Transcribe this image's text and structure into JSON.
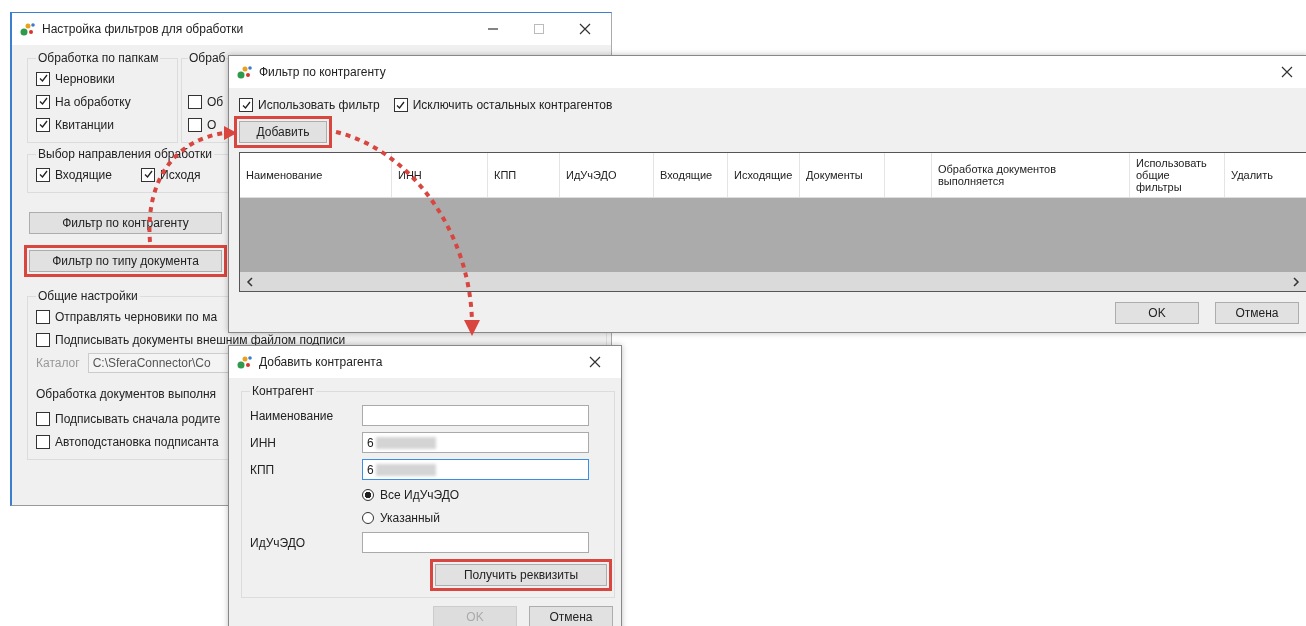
{
  "main_window": {
    "title": "Настройка фильтров для обработки",
    "folder_group": {
      "title": "Обработка по папкам",
      "items": [
        {
          "label": "Черновики",
          "checked": true
        },
        {
          "label": "На обработку",
          "checked": true
        },
        {
          "label": "Квитанции",
          "checked": true
        }
      ]
    },
    "second_group": {
      "title": "Обраб",
      "items": [
        {
          "label": "Об",
          "checked": false
        },
        {
          "label": "О",
          "checked": false
        }
      ]
    },
    "direction_group": {
      "title": "Выбор направления обработки",
      "items": [
        {
          "label": "Входящие",
          "checked": true
        },
        {
          "label": "Исходя",
          "checked": true
        }
      ]
    },
    "buttons": [
      {
        "label": "Фильтр по контрагенту",
        "highlighted": false
      },
      {
        "label": "Фильтр по типу документа",
        "highlighted": true
      }
    ],
    "general_group": {
      "title": "Общие настройки",
      "items": [
        {
          "label": "Отправлять черновики по ма",
          "checked": false
        },
        {
          "label": "Подписывать документы внешним файлом подписи",
          "checked": false
        }
      ],
      "catalog": {
        "label": "Каталог",
        "value": "C:\\SferaConnector\\Co",
        "disabled": true
      }
    },
    "processing_group": {
      "title": "Обработка документов выполня",
      "items": [
        {
          "label": "Подписывать сначала родите",
          "checked": false
        },
        {
          "label": "Автоподстановка подписанта",
          "checked": false
        }
      ]
    }
  },
  "counterparty_filter": {
    "title": "Фильтр по контрагенту",
    "options": [
      {
        "label": "Использовать фильтр",
        "checked": true
      },
      {
        "label": "Исключить остальных контрагентов",
        "checked": true
      }
    ],
    "add_button": {
      "label": "Добавить",
      "highlighted": true
    },
    "table": {
      "columns": [
        {
          "label": "Наименование"
        },
        {
          "label": "ИНН"
        },
        {
          "label": "КПП"
        },
        {
          "label": "ИдУчЭДО"
        },
        {
          "label": "Входящие"
        },
        {
          "label": "Исходящие"
        },
        {
          "label": "Документы"
        },
        {},
        {
          "label": "Обработка документов выполняется"
        },
        {
          "label": "Использовать общие фильтры"
        },
        {
          "label": "Удалить"
        }
      ]
    },
    "buttons": [
      {
        "label": "OK",
        "disabled": false
      },
      {
        "label": "Отмена",
        "disabled": false
      }
    ]
  },
  "add_counterparty": {
    "title": "Добавить контрагента",
    "group_title": "Контрагент",
    "fields": [
      {
        "label": "Наименование",
        "focused": false
      },
      {
        "label": "ИНН",
        "value": "6",
        "redacted": true,
        "focused": false
      },
      {
        "label": "КПП",
        "value": "6",
        "redacted": true,
        "focused": true
      }
    ],
    "radios": [
      {
        "label": "Все ИдУчЭДО",
        "selected": true
      },
      {
        "label": "Указанный",
        "selected": false
      }
    ],
    "id_field": {
      "label": "ИдУчЭДО",
      "focused": false
    },
    "fetch_button": {
      "label": "Получить реквизиты",
      "highlighted": true
    },
    "buttons": [
      {
        "label": "OK",
        "disabled": true
      },
      {
        "label": "Отмена",
        "disabled": false
      }
    ]
  }
}
